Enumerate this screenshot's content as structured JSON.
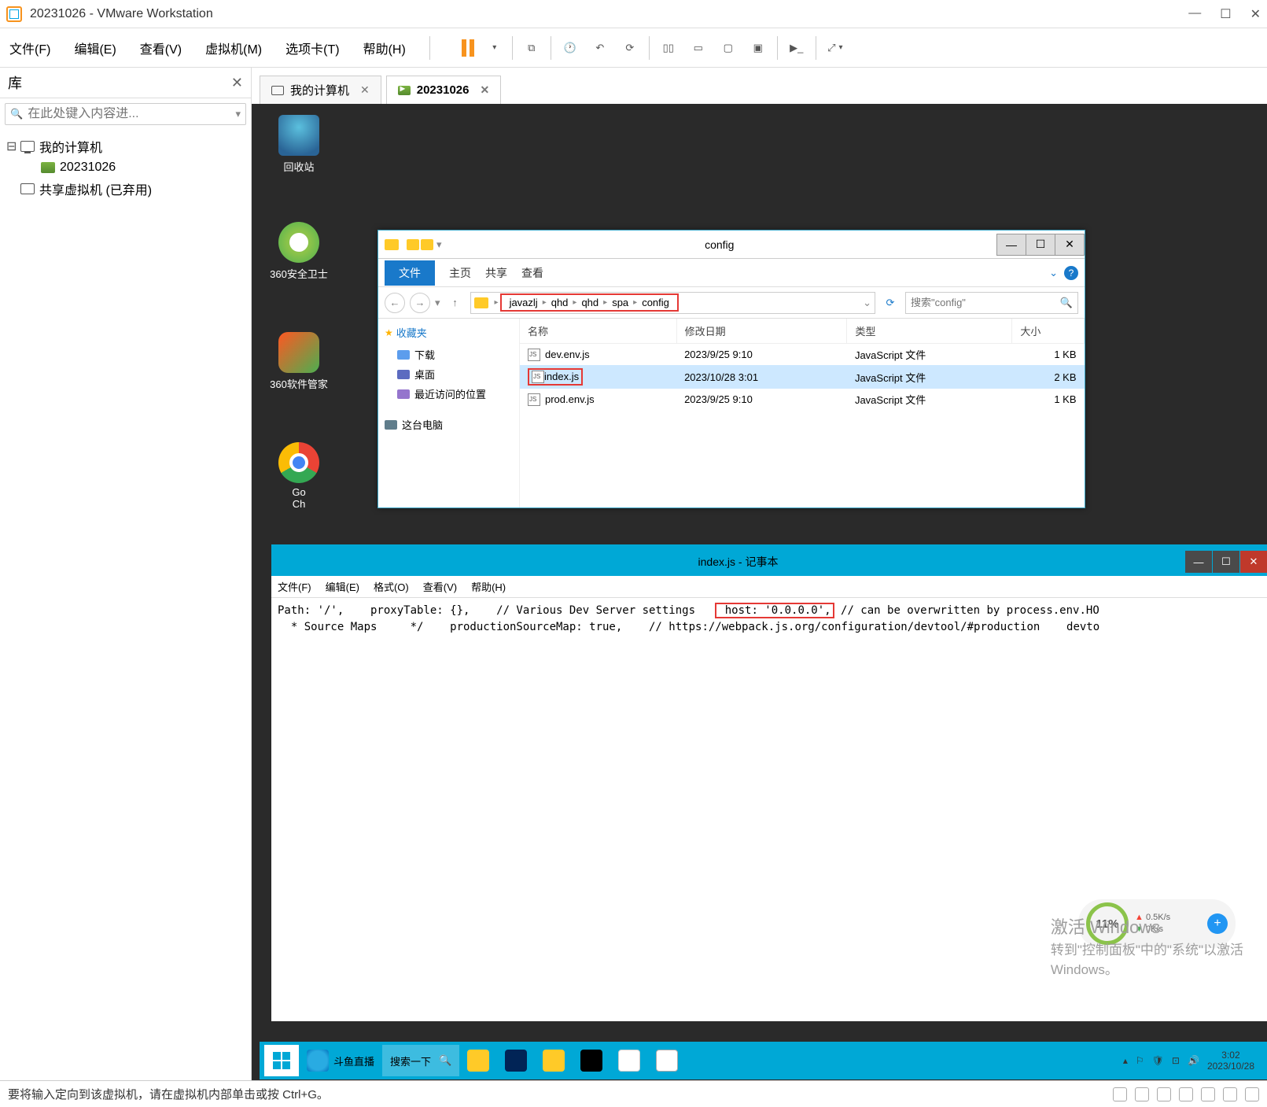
{
  "vmware": {
    "title": "20231026 - VMware Workstation",
    "menu": [
      "文件(F)",
      "编辑(E)",
      "查看(V)",
      "虚拟机(M)",
      "选项卡(T)",
      "帮助(H)"
    ]
  },
  "library": {
    "title": "库",
    "search_placeholder": "在此处键入内容进...",
    "nodes": {
      "root": "我的计算机",
      "vm": "20231026",
      "shared": "共享虚拟机 (已弃用)"
    }
  },
  "tabs": {
    "home": "我的计算机",
    "active": "20231026"
  },
  "desktop": {
    "trash": "回收站",
    "d360": "360安全卫士",
    "sw": "360软件管家",
    "chrome_prefix": "Go",
    "chrome_suffix": "Ch"
  },
  "explorer": {
    "title": "config",
    "ribbon": {
      "file": "文件",
      "home": "主页",
      "share": "共享",
      "view": "查看"
    },
    "breadcrumb": [
      "javazlj",
      "qhd",
      "qhd",
      "spa",
      "config"
    ],
    "search_placeholder": "搜索\"config\"",
    "side": {
      "fav": "收藏夹",
      "downloads": "下载",
      "desktop": "桌面",
      "recent": "最近访问的位置",
      "thispc": "这台电脑"
    },
    "cols": {
      "name": "名称",
      "date": "修改日期",
      "type": "类型",
      "size": "大小"
    },
    "rows": [
      {
        "name": "dev.env.js",
        "date": "2023/9/25 9:10",
        "type": "JavaScript 文件",
        "size": "1 KB",
        "sel": false,
        "hl": false
      },
      {
        "name": "index.js",
        "date": "2023/10/28 3:01",
        "type": "JavaScript 文件",
        "size": "2 KB",
        "sel": true,
        "hl": true
      },
      {
        "name": "prod.env.js",
        "date": "2023/9/25 9:10",
        "type": "JavaScript 文件",
        "size": "1 KB",
        "sel": false,
        "hl": false
      }
    ]
  },
  "notepad": {
    "title": "index.js - 记事本",
    "menu": [
      "文件(F)",
      "编辑(E)",
      "格式(O)",
      "查看(V)",
      "帮助(H)"
    ],
    "line1_pre": "Path: '/',    proxyTable: {},    // Various Dev Server settings   ",
    "line1_hl": " host: '0.0.0.0',",
    "line1_post": " // can be overwritten by process.env.HO",
    "line2": "  * Source Maps     */    productionSourceMap: true,    // https://webpack.js.org/configuration/devtool/#production    devto"
  },
  "watermark": {
    "l1": "激活 Windows",
    "l2": "转到\"控制面板\"中的\"系统\"以激活",
    "l3": "Windows。"
  },
  "gauge": {
    "pct": "11%",
    "up": "0.5K/s",
    "dn": "0K/s"
  },
  "taskbar": {
    "ie_label": "斗鱼直播",
    "search": "搜索一下",
    "clock": {
      "time": "3:02",
      "date": "2023/10/28"
    }
  },
  "statusbar": {
    "msg": "要将输入定向到该虚拟机，请在虚拟机内部单击或按 Ctrl+G。"
  }
}
